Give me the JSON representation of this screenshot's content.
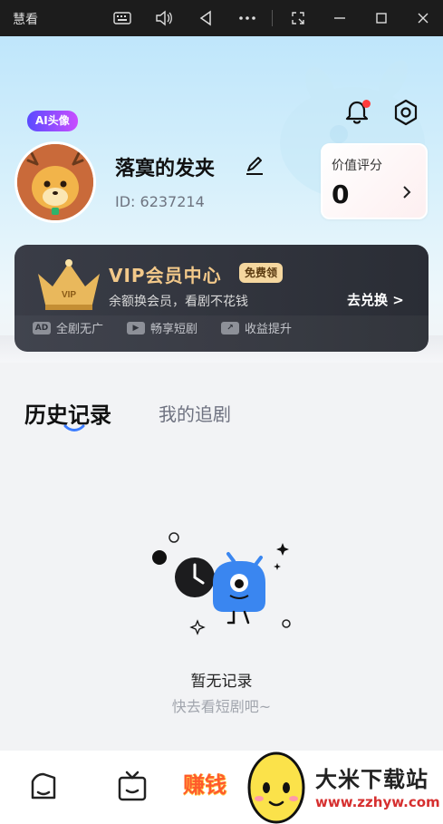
{
  "window": {
    "title": "慧看",
    "controls": [
      "keyboard-icon",
      "volume-icon",
      "back-icon",
      "more-icon",
      "screenshot-icon",
      "minimize-icon",
      "maximize-icon",
      "close-icon"
    ]
  },
  "header": {
    "notification_dot_color": "#ff3b3b",
    "ai_badge": "AI头像",
    "username": "落寞的发夹",
    "user_id": "ID: 6237214",
    "score": {
      "label": "价值评分",
      "value": "0"
    }
  },
  "vip": {
    "title": "VIP会员中心",
    "badge": "免费领",
    "subtitle": "余额换会员，看剧不花钱",
    "cta": "去兑换 >",
    "features": [
      {
        "icon": "ad-icon",
        "icon_text": "AD",
        "label": "全剧无广"
      },
      {
        "icon": "play-icon",
        "icon_text": "▶",
        "label": "畅享短剧"
      },
      {
        "icon": "trend-icon",
        "icon_text": "↗",
        "label": "收益提升"
      }
    ],
    "accent_color": "#f3c98a"
  },
  "tabs": [
    {
      "label": "历史记录",
      "active": true
    },
    {
      "label": "我的追剧",
      "active": false
    }
  ],
  "empty_state": {
    "title": "暂无记录",
    "subtitle": "快去看短剧吧~"
  },
  "bottom_nav": {
    "items": [
      "home-icon",
      "tv-icon"
    ],
    "earn_label": "赚钱"
  },
  "watermark": {
    "title": "大米下载站",
    "url": "www.zzhyw.com"
  }
}
